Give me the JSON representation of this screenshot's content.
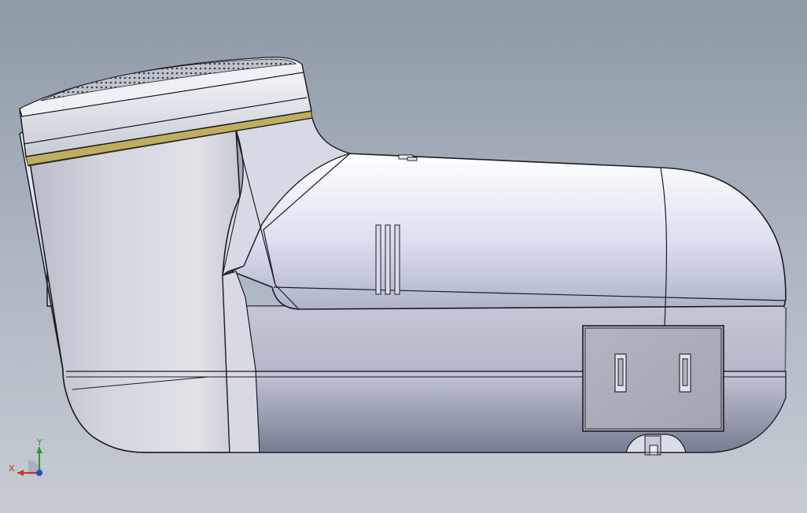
{
  "viewport": {
    "background_top": "#8f99a6",
    "background_bottom": "#c7ccd3"
  },
  "model": {
    "body_main_color": "#d4d8e6",
    "body_shadow_color": "#7c8297",
    "upper_shell_color": "#e9ecf7",
    "trim_ring_color": "#c2b15a",
    "edge_color": "#1b1d24",
    "rib_count": 3,
    "prong_count": 2
  },
  "triad": {
    "x_label": "X",
    "y_label": "Y",
    "x_color": "#d42b2b",
    "y_color": "#2d9a38",
    "origin_color": "#2d48c7"
  }
}
